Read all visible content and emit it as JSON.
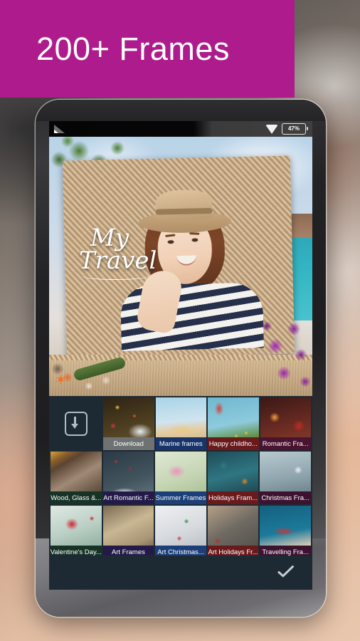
{
  "banner": {
    "title": "200+  Frames",
    "bg_color": "#ad1b8c",
    "text_color": "#ffffff"
  },
  "statusbar": {
    "signal_icon": "signal-bars-icon",
    "wifi_icon": "wifi-icon",
    "battery_label": "47%"
  },
  "canvas": {
    "caption_line1": "My",
    "caption_line2": "Travel",
    "frame_name": "travel-rope-frame"
  },
  "grid": {
    "download_button": {
      "icon": "download-icon"
    },
    "rows": [
      [
        {
          "label": "Download",
          "label_color": "#6e7273",
          "accent": "#c7cbc6"
        },
        {
          "label": "Marine frames",
          "label_color": "#18356b",
          "accent": "#7fb4d8"
        },
        {
          "label": "Happy childho...",
          "label_color": "#6b1a1c",
          "accent": "#d1534a"
        },
        {
          "label": "Romantic Fra...",
          "label_color": "#4a1330",
          "accent": "#c4312f"
        }
      ],
      [
        {
          "label": "Wood, Glass &...",
          "label_color": "#163326",
          "accent": "#8b6035"
        },
        {
          "label": "Art Romantic F...",
          "label_color": "#231a4a",
          "accent": "#b8243f"
        },
        {
          "label": "Summer Frames",
          "label_color": "#1c3f79",
          "accent": "#e38fb8"
        },
        {
          "label": "Holidays Fram...",
          "label_color": "#6b1a1c",
          "accent": "#2d6b72"
        },
        {
          "label": "Christmas Fra...",
          "label_color": "#3c1230",
          "accent": "#a8c4cf"
        }
      ],
      [
        {
          "label": "Valentine's Day...",
          "label_color": "#163326",
          "accent": "#cf2f3c"
        },
        {
          "label": "Art Frames",
          "label_color": "#231a4a",
          "accent": "#b9a47f"
        },
        {
          "label": "Art Christmas...",
          "label_color": "#1c3f79",
          "accent": "#dfe4e8"
        },
        {
          "label": "Art Holidays Fr...",
          "label_color": "#6b1a1c",
          "accent": "#6f6a62"
        },
        {
          "label": "Travelling Fra...",
          "label_color": "#3c1230",
          "accent": "#1d6d8c"
        }
      ]
    ]
  },
  "bottombar": {
    "confirm_icon": "checkmark-icon"
  }
}
